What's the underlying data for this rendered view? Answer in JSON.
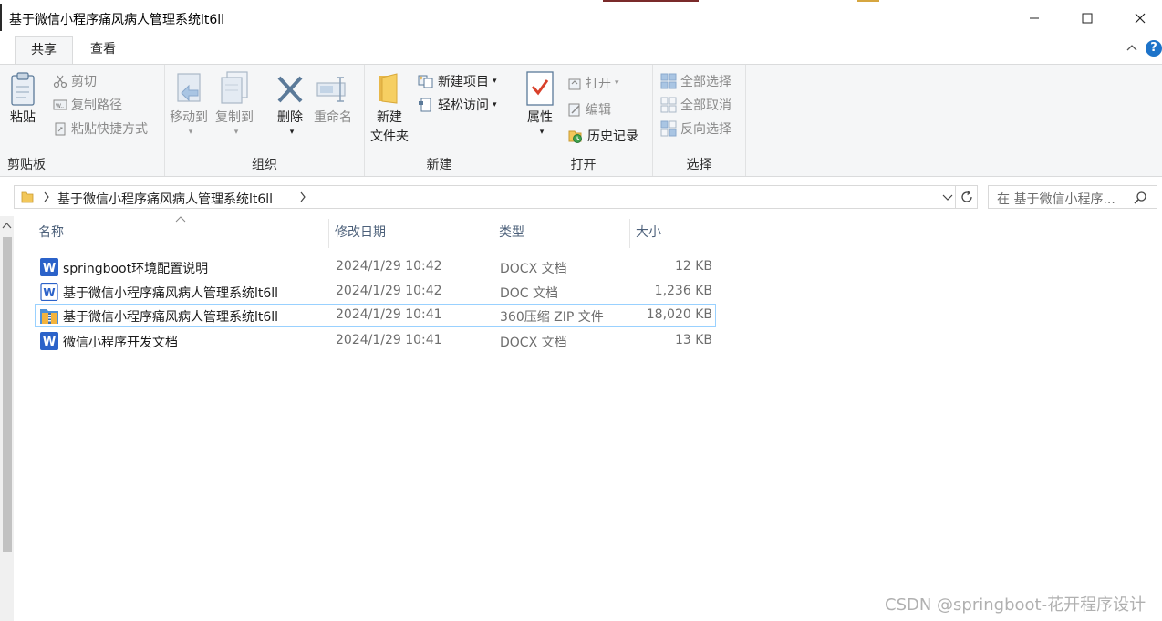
{
  "window": {
    "title": "基于微信小程序痛风病人管理系统lt6ll",
    "minimize": "minimize",
    "maximize": "maximize",
    "close": "close"
  },
  "tabs": [
    {
      "label": "共享",
      "active": true
    },
    {
      "label": "查看",
      "active": false
    }
  ],
  "help_label": "?",
  "ribbon": {
    "clipboard": {
      "label": "剪贴板",
      "paste": "粘贴",
      "cut": "剪切",
      "copy_path": "复制路径",
      "paste_shortcut": "粘贴快捷方式"
    },
    "organize": {
      "label": "组织",
      "move_to": "移动到",
      "copy_to": "复制到",
      "delete": "删除",
      "rename": "重命名"
    },
    "new": {
      "label": "新建",
      "new_folder": "新建\n文件夹",
      "new_folder_line1": "新建",
      "new_folder_line2": "文件夹",
      "new_item": "新建项目",
      "easy_access": "轻松访问"
    },
    "open": {
      "label": "打开",
      "properties": "属性",
      "open": "打开",
      "edit": "编辑",
      "history": "历史记录"
    },
    "select": {
      "label": "选择",
      "select_all": "全部选择",
      "select_none": "全部取消",
      "invert": "反向选择"
    }
  },
  "address": {
    "crumb": "基于微信小程序痛风病人管理系统lt6ll",
    "search_placeholder": "在 基于微信小程序..."
  },
  "columns": {
    "name": "名称",
    "modified": "修改日期",
    "type": "类型",
    "size": "大小"
  },
  "files": [
    {
      "name": "springboot环境配置说明",
      "modified": "2024/1/29 10:42",
      "type": "DOCX 文档",
      "size": "12 KB",
      "icon": "word-icon",
      "selected": false
    },
    {
      "name": "基于微信小程序痛风病人管理系统lt6ll",
      "modified": "2024/1/29 10:42",
      "type": "DOC 文档",
      "size": "1,236 KB",
      "icon": "word-doc-icon",
      "selected": false
    },
    {
      "name": "基于微信小程序痛风病人管理系统lt6ll",
      "modified": "2024/1/29 10:41",
      "type": "360压缩 ZIP 文件",
      "size": "18,020 KB",
      "icon": "zip-icon",
      "selected": true
    },
    {
      "name": "微信小程序开发文档",
      "modified": "2024/1/29 10:41",
      "type": "DOCX 文档",
      "size": "13 KB",
      "icon": "word-icon",
      "selected": false
    }
  ],
  "watermark": "CSDN @springboot-花开程序设计",
  "colors": {
    "accent": "#1d73c9",
    "selection_border": "#99d1ff",
    "ribbon_bg": "#f5f6f7",
    "header_text": "#4c607a"
  }
}
